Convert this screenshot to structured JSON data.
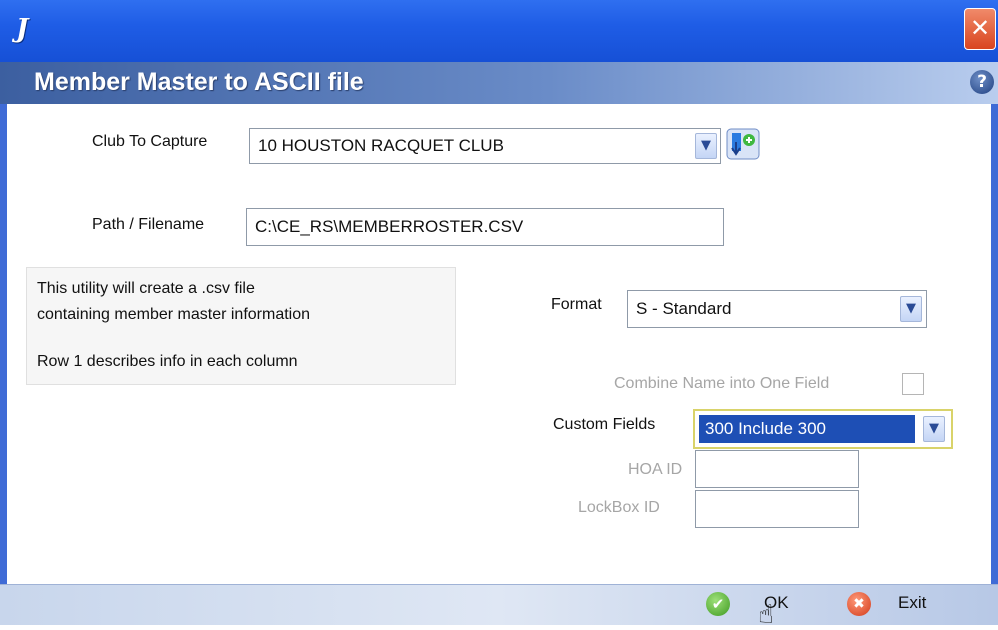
{
  "window": {
    "app_glyph": "J",
    "close_glyph": "✕",
    "title": "Member Master to ASCII file",
    "help_glyph": "?"
  },
  "club": {
    "label": "Club To Capture",
    "value": "10 HOUSTON RACQUET CLUB",
    "dropdown_glyph": "▼",
    "action_icon": "export-icon"
  },
  "path": {
    "label": "Path / Filename",
    "value": "C:\\CE_RS\\MEMBERROSTER.CSV"
  },
  "info": {
    "line1": "This utility will create a .csv file",
    "line2": "containing member master information",
    "line3": "Row 1 describes info in each column"
  },
  "format": {
    "label": "Format",
    "value": "S - Standard",
    "dropdown_glyph": "▼"
  },
  "combine": {
    "label": "Combine Name into One Field",
    "checked": false
  },
  "custom_fields": {
    "label": "Custom Fields",
    "value": "300 Include 300",
    "dropdown_glyph": "▼"
  },
  "hoa": {
    "label": "HOA ID",
    "value": ""
  },
  "lockbox": {
    "label": "LockBox ID",
    "value": ""
  },
  "footer": {
    "ok_label": "OK",
    "ok_icon_glyph": "✔",
    "exit_label": "Exit",
    "exit_icon_glyph": "✖"
  },
  "colors": {
    "titlebar": "#1f5de6",
    "header_start": "#3c5fa0",
    "selection": "#1e4fb5",
    "ok_green": "#3e9a20",
    "exit_red": "#d23a1a"
  }
}
